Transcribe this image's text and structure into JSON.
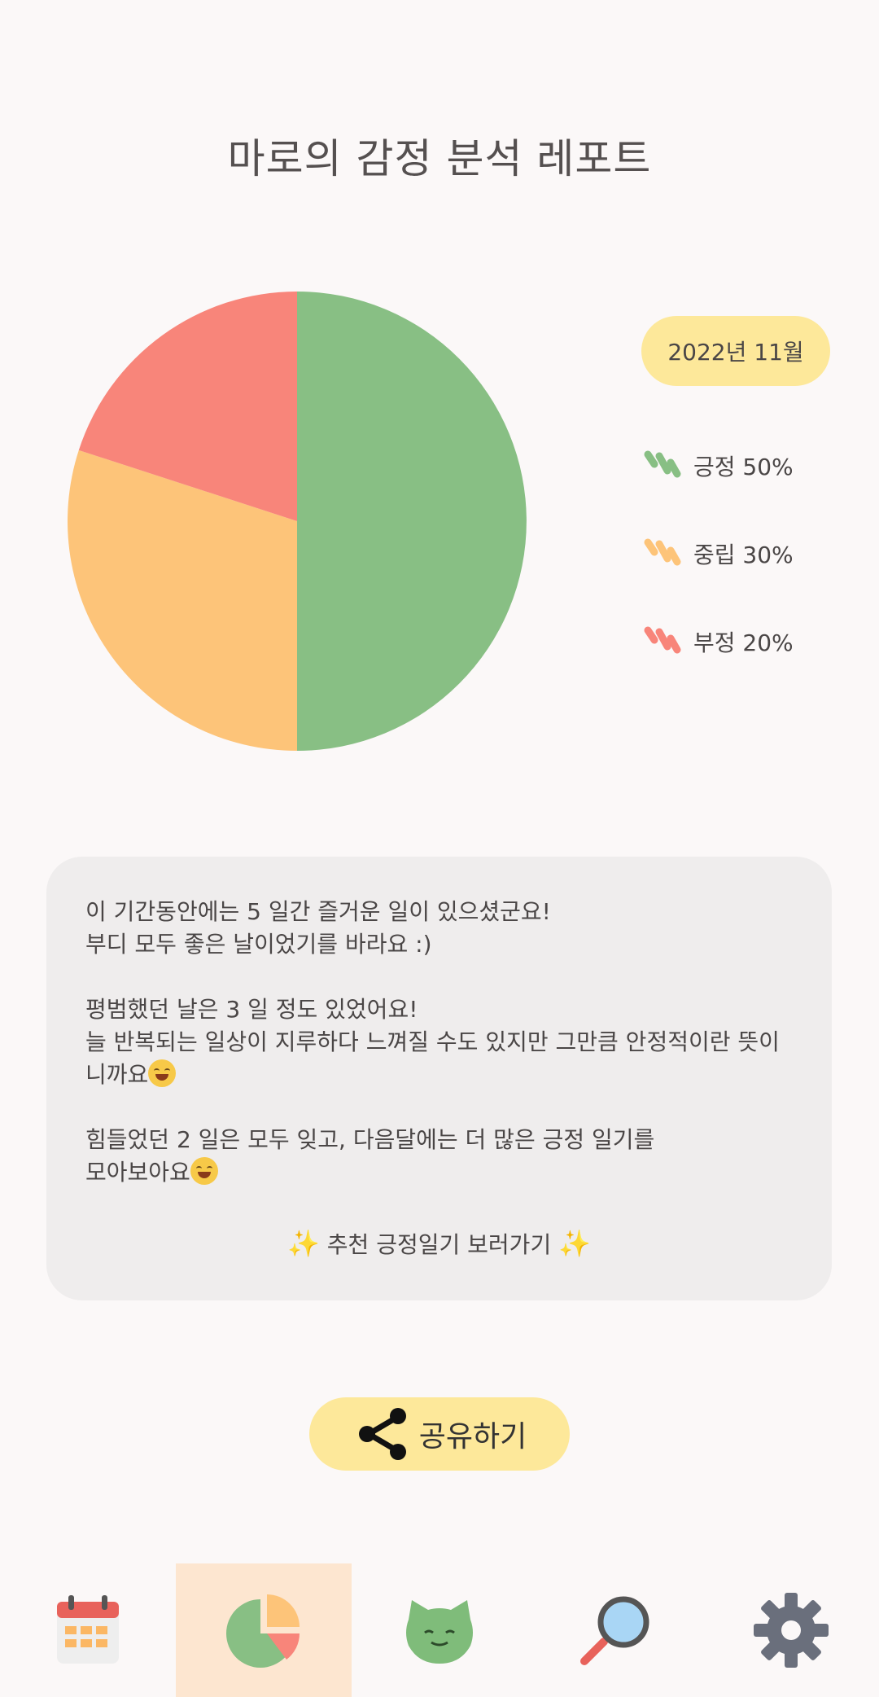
{
  "header": {
    "title": "마로의 감정 분석 레포트"
  },
  "period": {
    "label": "2022년 11월"
  },
  "chart_data": {
    "type": "pie",
    "slices": [
      {
        "name": "긍정",
        "value": 50,
        "color": "#88bf84"
      },
      {
        "name": "중립",
        "value": 30,
        "color": "#fdc479"
      },
      {
        "name": "부정",
        "value": 20,
        "color": "#f8857a"
      }
    ]
  },
  "legend": {
    "items": [
      {
        "label": "긍정 50%",
        "color": "#88bf84"
      },
      {
        "label": "중립 30%",
        "color": "#fdc479"
      },
      {
        "label": "부정 20%",
        "color": "#f8857a"
      }
    ]
  },
  "report": {
    "positive_text": "이 기간동안에는 5 일간 즐거운 일이 있으셨군요!\n부디 모두 좋은 날이었기를 바라요 :)",
    "neutral_text": "평범했던 날은 3 일 정도 있었어요!\n늘 반복되는 일상이 지루하다 느껴질 수도 있지만 그만큼 안정적이란 뜻이니까요",
    "negative_text": "힘들었던 2 일은 모두 잊고, 다음달에는 더 많은 긍정 일기를\n모아보아요",
    "recommend_label": "추천 긍정일기 보러가기"
  },
  "share": {
    "label": "공유하기"
  },
  "tabbar": {
    "items": [
      {
        "icon": "calendar-icon",
        "active": false
      },
      {
        "icon": "pie-chart-icon",
        "active": true
      },
      {
        "icon": "character-icon",
        "active": false
      },
      {
        "icon": "search-icon",
        "active": false
      },
      {
        "icon": "gear-icon",
        "active": false
      }
    ]
  }
}
